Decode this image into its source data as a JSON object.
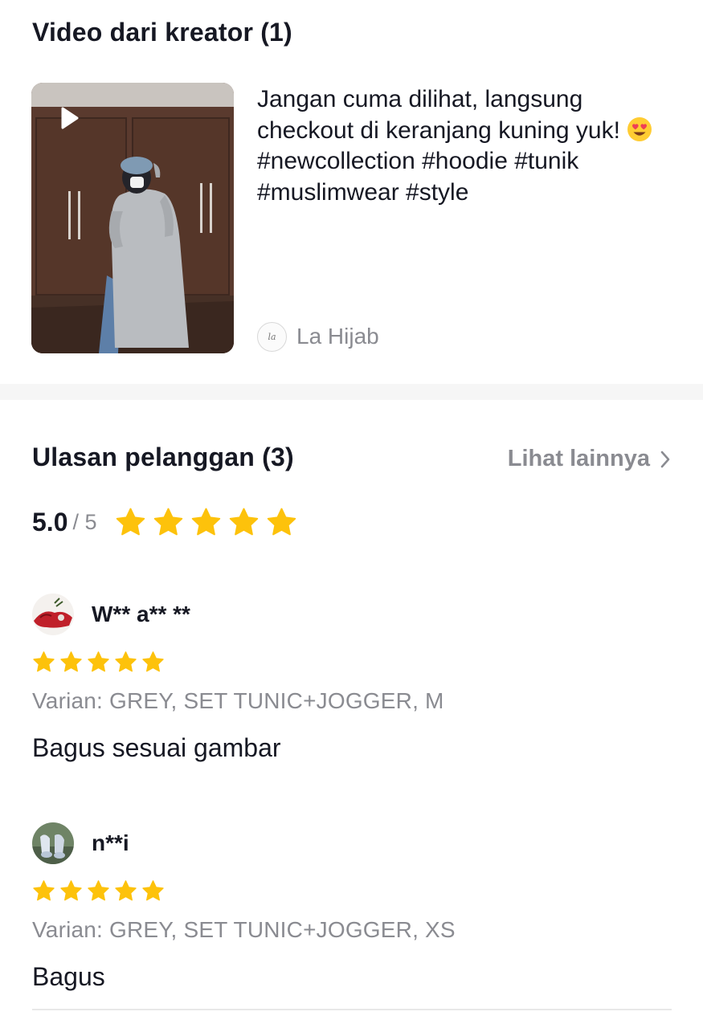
{
  "video_section": {
    "title": "Video dari kreator (1)",
    "caption": "Jangan cuma dilihat, langsung checkout di keranjang kuning yuk! ",
    "caption_emoji": "😍",
    "caption_tags": " #newcollection #hoodie #tunik #muslimwear #style",
    "creator_name": "La Hijab",
    "creator_logo_text": "la"
  },
  "reviews_section": {
    "title": "Ulasan pelanggan (3)",
    "see_more": "Lihat lainnya",
    "average": "5.0",
    "max": "/ 5",
    "average_stars": 5,
    "reviews": [
      {
        "name": "W** a** **",
        "stars": 5,
        "variant": "Varian: GREY, SET TUNIC+JOGGER, M",
        "text": "Bagus sesuai gambar"
      },
      {
        "name": "n**i",
        "stars": 5,
        "variant": "Varian: GREY, SET TUNIC+JOGGER, XS",
        "text": "Bagus"
      }
    ]
  },
  "colors": {
    "star": "#FDC20B",
    "muted": "#8a8b91",
    "text": "#161823"
  },
  "icons": [
    "play-icon",
    "chevron-right-icon",
    "star-icon"
  ]
}
